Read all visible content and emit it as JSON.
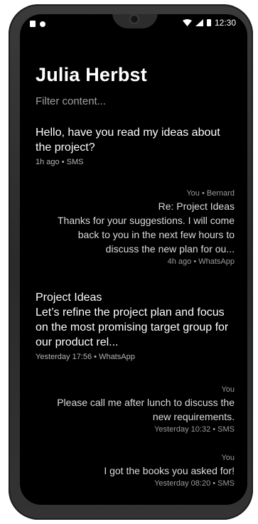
{
  "status_bar": {
    "time": "12:30",
    "left_icons": [
      "sim-card-icon",
      "notification-dot-icon"
    ],
    "right_icons": [
      "wifi-icon",
      "signal-icon",
      "battery-icon"
    ]
  },
  "title": "Julia Herbst",
  "filter_placeholder": "Filter content...",
  "messages": [
    {
      "direction": "incoming",
      "body": "Hello, have you read my ideas about the project?",
      "meta": "1h ago • SMS"
    },
    {
      "direction": "outgoing",
      "header": "You • Bernard",
      "subject": "Re: Project Ideas",
      "body": "Thanks for your suggestions. I will come back to you in the next few hours to discuss the new plan for ou...",
      "meta": "4h ago • WhatsApp"
    },
    {
      "direction": "incoming",
      "subject": "Project Ideas",
      "body": "Let’s refine the project plan and focus on the most promising target group for our product rel...",
      "meta": "Yesterday 17:56 • WhatsApp"
    },
    {
      "direction": "outgoing",
      "header": "You",
      "body": "Please call me after lunch to discuss the new requirements.",
      "meta": "Yesterday 10:32 • SMS"
    },
    {
      "direction": "outgoing",
      "header": "You",
      "body": "I got the  books you asked for!",
      "meta": "Yesterday 08:20 • SMS"
    }
  ]
}
